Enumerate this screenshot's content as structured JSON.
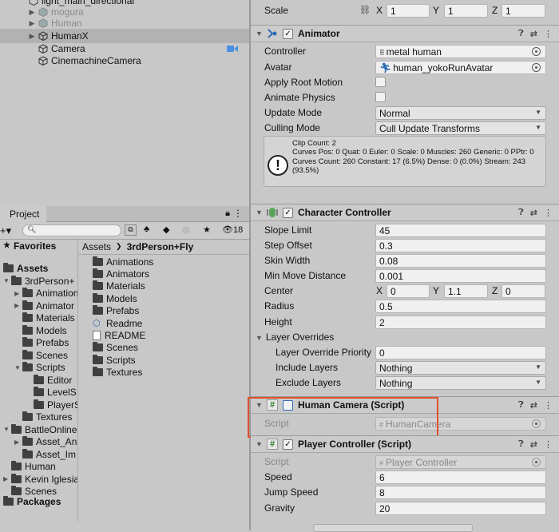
{
  "hierarchy": {
    "items": [
      {
        "label": "light_main_directional",
        "dim": false,
        "arrow": false,
        "icon": "cube-icon"
      },
      {
        "label": "mogura",
        "dim": true,
        "arrow": true,
        "icon": "prefab-icon"
      },
      {
        "label": "Human",
        "dim": true,
        "arrow": true,
        "icon": "prefab-icon"
      },
      {
        "label": "HumanX",
        "dim": false,
        "arrow": true,
        "icon": "cube-icon",
        "selected": true
      },
      {
        "label": "Camera",
        "dim": false,
        "arrow": false,
        "icon": "cube-icon",
        "badge": "camera-icon"
      },
      {
        "label": "CinemachineCamera",
        "dim": false,
        "arrow": false,
        "icon": "cube-icon"
      }
    ]
  },
  "project": {
    "tab_label": "Project",
    "search_placeholder": "",
    "hidden_count": "18",
    "favorites": "Favorites",
    "assets": "Assets",
    "packages": "Packages",
    "tree": [
      {
        "label": "3rdPerson+",
        "depth": 1,
        "arrow": "▼"
      },
      {
        "label": "Animation",
        "depth": 2,
        "arrow": "▶"
      },
      {
        "label": "Animator",
        "depth": 2,
        "arrow": "▶"
      },
      {
        "label": "Materials",
        "depth": 2,
        "arrow": ""
      },
      {
        "label": "Models",
        "depth": 2,
        "arrow": ""
      },
      {
        "label": "Prefabs",
        "depth": 2,
        "arrow": ""
      },
      {
        "label": "Scenes",
        "depth": 2,
        "arrow": ""
      },
      {
        "label": "Scripts",
        "depth": 2,
        "arrow": "▼"
      },
      {
        "label": "Editor",
        "depth": 3,
        "arrow": ""
      },
      {
        "label": "LevelS",
        "depth": 3,
        "arrow": ""
      },
      {
        "label": "PlayerS",
        "depth": 3,
        "arrow": ""
      },
      {
        "label": "Textures",
        "depth": 2,
        "arrow": ""
      },
      {
        "label": "BattleOnline",
        "depth": 1,
        "arrow": "▼"
      },
      {
        "label": "Asset_An",
        "depth": 2,
        "arrow": "▶"
      },
      {
        "label": "Asset_Im",
        "depth": 2,
        "arrow": ""
      },
      {
        "label": "Human",
        "depth": 1,
        "arrow": ""
      },
      {
        "label": "Kevin Iglesia",
        "depth": 1,
        "arrow": "▶"
      },
      {
        "label": "Scenes",
        "depth": 1,
        "arrow": ""
      }
    ],
    "breadcrumb": [
      "Assets",
      "3rdPerson+Fly"
    ],
    "files": [
      {
        "label": "Animations",
        "icon": "folder"
      },
      {
        "label": "Animators",
        "icon": "folder"
      },
      {
        "label": "Materials",
        "icon": "folder"
      },
      {
        "label": "Models",
        "icon": "folder"
      },
      {
        "label": "Prefabs",
        "icon": "folder"
      },
      {
        "label": "Readme",
        "icon": "readme"
      },
      {
        "label": "README",
        "icon": "doc"
      },
      {
        "label": "Scenes",
        "icon": "folder"
      },
      {
        "label": "Scripts",
        "icon": "folder"
      },
      {
        "label": "Textures",
        "icon": "folder"
      }
    ]
  },
  "inspector": {
    "scale": {
      "label": "Scale",
      "x": "1",
      "y": "1",
      "z": "1"
    },
    "animator": {
      "title": "Animator",
      "controller_label": "Controller",
      "controller_value": "metal human",
      "avatar_label": "Avatar",
      "avatar_value": "human_yokoRunAvatar",
      "apply_root_motion": "Apply Root Motion",
      "animate_physics": "Animate Physics",
      "update_mode_label": "Update Mode",
      "update_mode_value": "Normal",
      "culling_mode_label": "Culling Mode",
      "culling_mode_value": "Cull Update Transforms",
      "info": "Clip Count: 2\nCurves Pos: 0 Quat: 0 Euler: 0 Scale: 0 Muscles: 260 Generic: 0 PPtr: 0\nCurves Count: 260 Constant: 17 (6.5%) Dense: 0 (0.0%) Stream: 243 (93.5%)"
    },
    "character_controller": {
      "title": "Character Controller",
      "slope_limit_label": "Slope Limit",
      "slope_limit": "45",
      "step_offset_label": "Step Offset",
      "step_offset": "0.3",
      "skin_width_label": "Skin Width",
      "skin_width": "0.08",
      "min_move_label": "Min Move Distance",
      "min_move": "0.001",
      "center_label": "Center",
      "center_x": "0",
      "center_y": "1.1",
      "center_z": "0",
      "radius_label": "Radius",
      "radius": "0.5",
      "height_label": "Height",
      "height": "2",
      "layer_overrides": "Layer Overrides",
      "priority_label": "Layer Override Priority",
      "priority": "0",
      "include_label": "Include Layers",
      "include": "Nothing",
      "exclude_label": "Exclude Layers",
      "exclude": "Nothing"
    },
    "human_camera": {
      "title": "Human Camera (Script)",
      "script_label": "Script",
      "script_value": "HumanCamera"
    },
    "player_controller": {
      "title": "Player Controller (Script)",
      "script_label": "Script",
      "script_value": "Player Controller",
      "speed_label": "Speed",
      "speed": "6",
      "jump_label": "Jump Speed",
      "jump": "8",
      "gravity_label": "Gravity",
      "gravity": "20"
    },
    "axis": {
      "x": "X",
      "y": "Y",
      "z": "Z"
    }
  },
  "colors": {
    "highlight": "#e0502c",
    "selected_row": "#b2b2b2",
    "panel": "#c8c8c8"
  }
}
